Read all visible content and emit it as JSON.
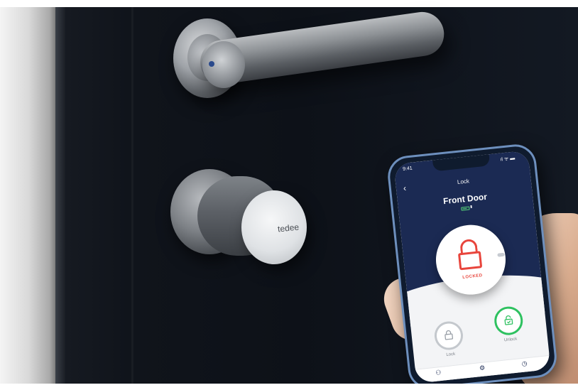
{
  "lock_brand": "tedee",
  "phone": {
    "status_time": "9:41",
    "status_icons": "ıl ᯤ ▬",
    "back_glyph": "‹",
    "screen_title": "Lock",
    "door_name": "Front Door",
    "battery_level": 0.8,
    "battery_label": "▮",
    "lock_state": "LOCKED",
    "lock_button_label": "Lock",
    "unlock_button_label": "Unlock",
    "tabs": [
      {
        "icon": "users-icon",
        "glyph": "⚇"
      },
      {
        "icon": "settings-icon",
        "glyph": "⚙"
      },
      {
        "icon": "history-icon",
        "glyph": "◷"
      }
    ],
    "colors": {
      "header": "#1b2a53",
      "locked": "#e8453c",
      "unlock_ring": "#2ec160",
      "lock_ring": "#c4c8cd"
    }
  }
}
